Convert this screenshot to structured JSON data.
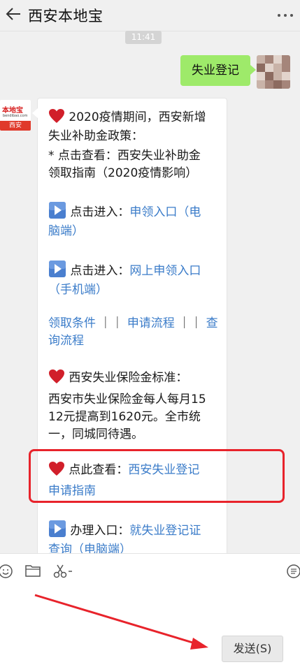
{
  "header": {
    "title": "西安本地宝",
    "back_icon": "arrow-left-icon",
    "more_icon": "more-vert-icon"
  },
  "timestamp": "11:41",
  "sent_message": {
    "text": "失业登记"
  },
  "account": {
    "logo_text": "本地宝",
    "logo_sub": "bendibao.com",
    "logo_city": "西安"
  },
  "received_message": {
    "intro_line1": "2020疫情期间，西安新增",
    "intro_line2": "失业补助金政策：",
    "intro_line3": "* 点击查看：西安失业补助金",
    "intro_line4": "领取指南（2020疫情影响）",
    "entry1_prefix": "点击进入：",
    "entry1_link_a": "申领入口（电",
    "entry1_link_b": "脑端）",
    "entry2_prefix": "点击进入：",
    "entry2_link_a": "网上申领入口",
    "entry2_link_b": "（手机端）",
    "links_line_a_1": "领取条件",
    "links_line_sep1": "｜｜",
    "links_line_a_2": "申请流程",
    "links_line_sep2": "｜｜",
    "links_line_a_3": "查",
    "links_line_b": "询流程",
    "standard_title": "西安失业保险金标准：",
    "standard_line1": "西安市失业保险金每人每月15",
    "standard_line2": "12元提高到1620元。全市统",
    "standard_line3": "一，同城同待遇。",
    "check_prefix": "点此查看：",
    "check_link_a": "西安失业登记",
    "check_link_b": "申请指南",
    "handle_prefix": "办理入口：",
    "handle_link_a": "就失业登记证",
    "handle_link_b": "查询（电脑端）"
  },
  "input_bar": {
    "emoji_icon": "emoji-icon",
    "folder_icon": "folder-icon",
    "scissors_icon": "scissors-icon",
    "history_icon": "chat-history-icon",
    "send_label": "发送(S)"
  },
  "colors": {
    "sent_bubble": "#9eea6a",
    "link": "#3b7cc9",
    "highlight": "#e8232b",
    "heart": "#d11f2a"
  }
}
